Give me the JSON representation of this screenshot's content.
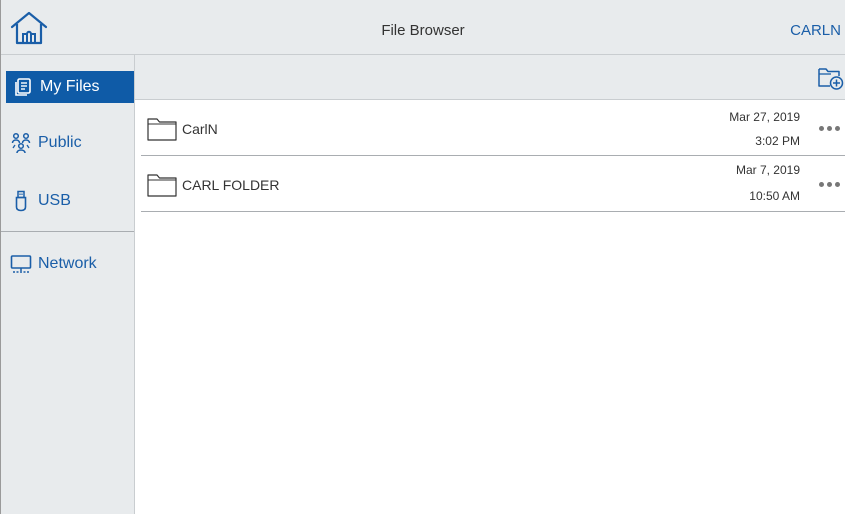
{
  "header": {
    "title": "File Browser",
    "user": "CARLN",
    "home_icon": "home-icon"
  },
  "sidebar": {
    "items": [
      {
        "label": "My Files",
        "icon": "my-files-icon",
        "active": true
      },
      {
        "label": "Public",
        "icon": "public-users-icon",
        "active": false
      },
      {
        "label": "USB",
        "icon": "usb-icon",
        "active": false
      },
      {
        "label": "Network",
        "icon": "network-monitor-icon",
        "active": false
      }
    ]
  },
  "toolbar": {
    "new_folder_icon": "new-folder-icon"
  },
  "files": [
    {
      "name": "CarlN",
      "date": "Mar 27, 2019",
      "time": "3:02 PM",
      "icon": "folder-icon"
    },
    {
      "name": "CARL FOLDER",
      "date": "Mar 7, 2019",
      "time": "10:50 AM",
      "icon": "folder-icon"
    }
  ],
  "colors": {
    "accent": "#0f5ba7",
    "link": "#1a5ea8",
    "bar_bg": "#e8ebed"
  }
}
